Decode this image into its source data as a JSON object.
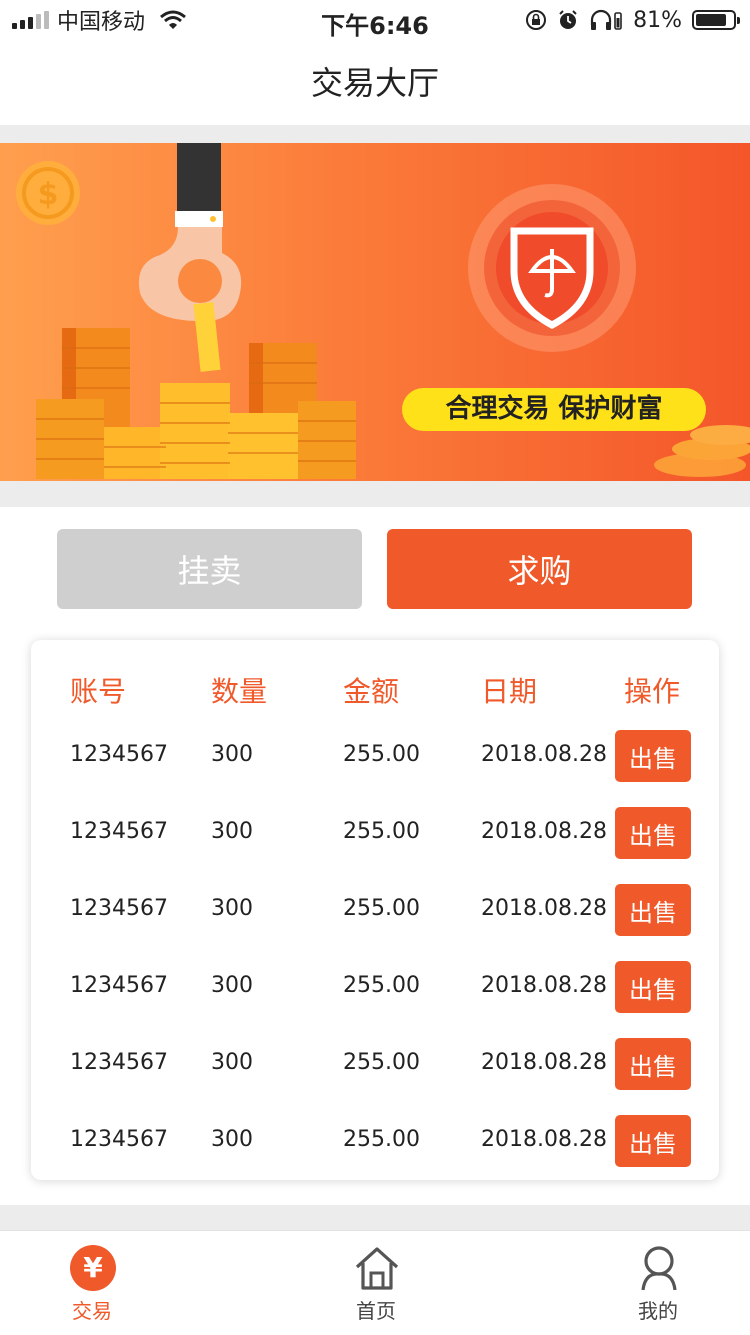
{
  "status_bar": {
    "carrier": "中国移动",
    "time": "下午6:46",
    "battery": "81%",
    "battery_level": 0.81
  },
  "nav": {
    "title": "交易大厅"
  },
  "banner": {
    "slogan": "合理交易 保护财富"
  },
  "actions": {
    "sell_list_label": "挂卖",
    "buy_label": "求购"
  },
  "table": {
    "headers": [
      "账号",
      "数量",
      "金额",
      "日期",
      "操作"
    ],
    "rows": [
      {
        "account": "1234567",
        "quantity": "300",
        "amount": "255.00",
        "date": "2018.08.28",
        "action": "出售"
      },
      {
        "account": "1234567",
        "quantity": "300",
        "amount": "255.00",
        "date": "2018.08.28",
        "action": "出售"
      },
      {
        "account": "1234567",
        "quantity": "300",
        "amount": "255.00",
        "date": "2018.08.28",
        "action": "出售"
      },
      {
        "account": "1234567",
        "quantity": "300",
        "amount": "255.00",
        "date": "2018.08.28",
        "action": "出售"
      },
      {
        "account": "1234567",
        "quantity": "300",
        "amount": "255.00",
        "date": "2018.08.28",
        "action": "出售"
      },
      {
        "account": "1234567",
        "quantity": "300",
        "amount": "255.00",
        "date": "2018.08.28",
        "action": "出售"
      }
    ]
  },
  "tabbar": {
    "items": [
      {
        "label": "交易",
        "icon": "yuan-icon",
        "active": true
      },
      {
        "label": "首页",
        "icon": "home-icon",
        "active": false
      },
      {
        "label": "我的",
        "icon": "user-icon",
        "active": false
      }
    ]
  },
  "colors": {
    "accent": "#f05a2b",
    "disabled": "#cfcfcf",
    "slogan_bg": "#ffe11a"
  }
}
